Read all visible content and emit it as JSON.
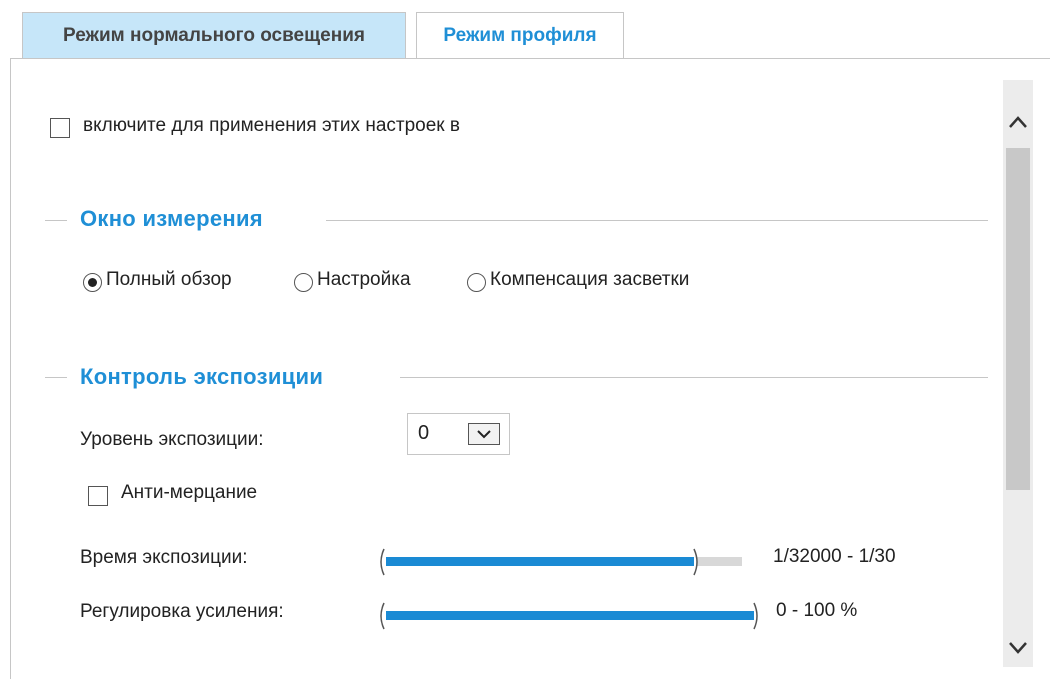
{
  "tabs": {
    "normal": "Режим нормального освещения",
    "profile": "Режим профиля",
    "active": "profile"
  },
  "enable_checkbox": {
    "label": "включите для применения этих настроек в",
    "checked": false
  },
  "measurement_window": {
    "title": "Окно измерения",
    "options": [
      {
        "label": "Полный обзор",
        "selected": true
      },
      {
        "label": "Настройка",
        "selected": false
      },
      {
        "label": "Компенсация засветки",
        "selected": false
      }
    ]
  },
  "exposure_control": {
    "title": "Контроль экспозиции",
    "exposure_level": {
      "label": "Уровень экспозиции:",
      "value": "0"
    },
    "anti_flicker": {
      "label": "Анти-мерцание",
      "checked": false
    },
    "exposure_time": {
      "label": "Время экспозиции:",
      "range_text": "1/32000 - 1/30",
      "fill_fraction": 0.87
    },
    "gain_control": {
      "label": "Регулировка усиления:",
      "range_text": "0 - 100 %",
      "fill_fraction": 1.0
    }
  },
  "colors": {
    "accent": "#1f8fd6",
    "tab_inactive_bg": "#c6e6f9",
    "slider_fill": "#1a8ad4",
    "slider_track": "#d8d8d8"
  },
  "icons": {
    "scroll_up": "chevron-up-icon",
    "scroll_down": "chevron-down-icon",
    "select_arrow": "chevron-down-icon"
  }
}
